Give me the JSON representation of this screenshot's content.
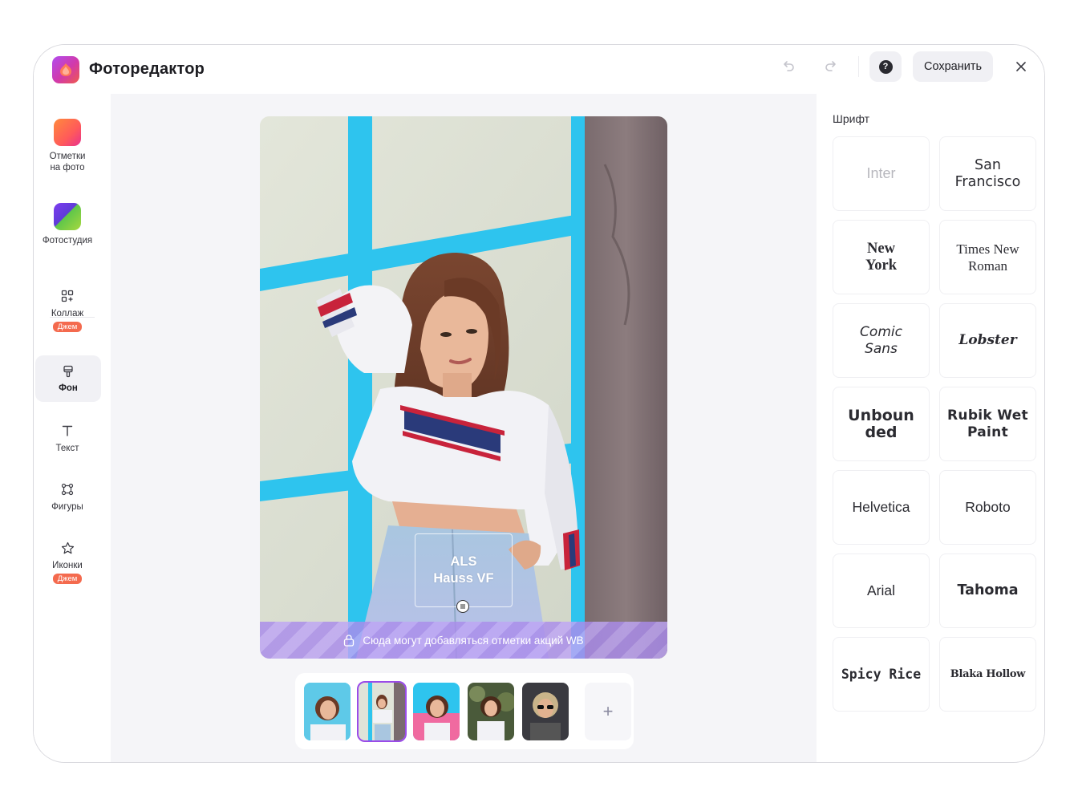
{
  "header": {
    "title": "Фоторедактор",
    "save_label": "Сохранить",
    "help_icon": "?",
    "undo_icon": "undo-icon",
    "redo_icon": "redo-icon",
    "close_icon": "close-icon"
  },
  "sidebar": {
    "items": [
      {
        "label": "Отметки на фото",
        "icon": "notes-app-icon"
      },
      {
        "label": "Фотостудия",
        "icon": "studio-app-icon"
      },
      {
        "label": "Коллаж",
        "badge": "Джем",
        "icon": "collage-icon"
      },
      {
        "label": "Фон",
        "icon": "brush-icon",
        "active": true
      },
      {
        "label": "Текст",
        "icon": "text-icon"
      },
      {
        "label": "Фигуры",
        "icon": "shapes-icon"
      },
      {
        "label": "Иконки",
        "badge": "Джем",
        "icon": "star-icon"
      }
    ]
  },
  "canvas": {
    "text_overlay": {
      "line1": "ALS",
      "line2": "Hauss VF"
    },
    "notice": "Сюда могут добавляться отметки акций WB",
    "thumbnails_count": 5,
    "selected_thumbnail": 2,
    "add_label": "+"
  },
  "panel": {
    "title": "Шрифт",
    "fonts": [
      "Inter",
      "San Francisco",
      "New York",
      "Times New Roman",
      "Comic Sans",
      "Lobster",
      "Unbounded",
      "Rubik Wet Paint",
      "Helvetica",
      "Roboto",
      "Arial",
      "Tahoma",
      "Spicy Rice",
      "Blaka Hollow"
    ],
    "unbounded_line1": "Unboun",
    "unbounded_line2": "ded"
  },
  "colors": {
    "accent": "#9a4be8",
    "badge": "#f46a4e",
    "frame_blue": "#2ec4ee",
    "notice_strip": "#b49cf0"
  }
}
